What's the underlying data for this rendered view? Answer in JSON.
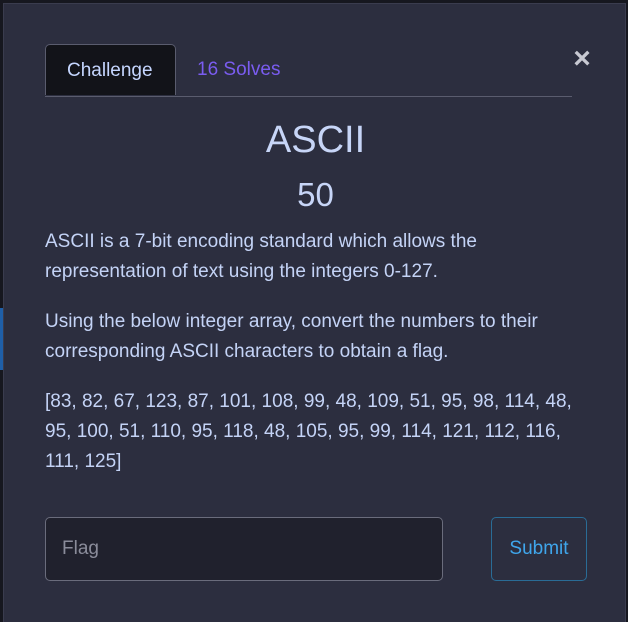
{
  "modal": {
    "close_glyph": "×",
    "tabs": [
      {
        "label": "Challenge",
        "active": true
      },
      {
        "label": "16 Solves",
        "active": false
      }
    ],
    "title": "ASCII",
    "points": "50",
    "description": [
      "ASCII is a 7-bit encoding standard which allows the representation of text using the integers 0-127.",
      "Using the below integer array, convert the numbers to their corresponding ASCII characters to obtain a flag.",
      "[83, 82, 67, 123, 87, 101, 108, 99, 48, 109, 51, 95, 98, 114, 48, 95, 100, 51, 110, 95, 118, 48, 105, 95, 99, 114, 121, 112, 116, 111, 125]"
    ],
    "flag_input": {
      "value": "",
      "placeholder": "Flag"
    },
    "submit_label": "Submit"
  },
  "colors": {
    "modal_bg": "#2c2e3f",
    "text": "#c4d3f6",
    "solves_tab": "#7a5cf0",
    "submit": "#3fa6ec"
  }
}
